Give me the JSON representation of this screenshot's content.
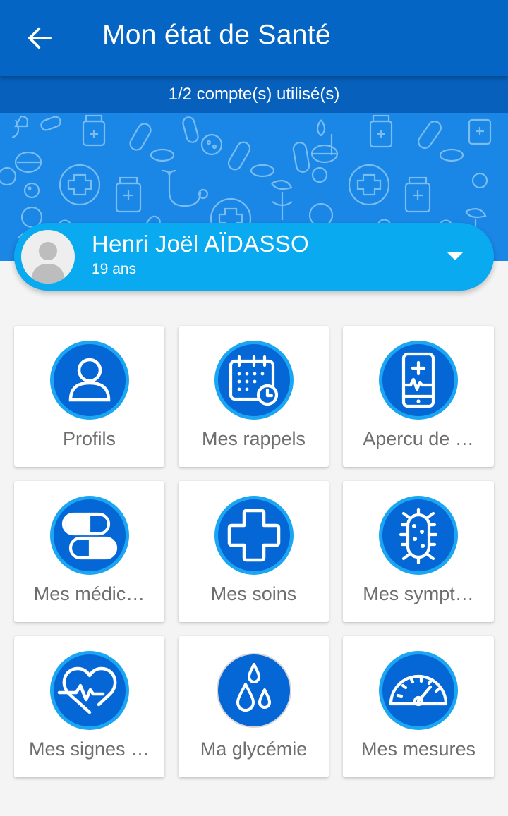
{
  "appbar": {
    "title": "Mon état de Santé",
    "back_icon": "arrow-left-icon"
  },
  "accounts_info": "1/2 compte(s) utilisé(s)",
  "profile": {
    "name": "Henri Joël AÏDASSO",
    "age": "19 ans"
  },
  "menu": [
    {
      "label": "Profils",
      "icon": "user-icon"
    },
    {
      "label": "Mes rappels",
      "icon": "calendar-clock-icon"
    },
    {
      "label": "Apercu de …",
      "icon": "phone-health-icon"
    },
    {
      "label": "Mes médic…",
      "icon": "pills-icon"
    },
    {
      "label": "Mes soins",
      "icon": "cross-icon"
    },
    {
      "label": "Mes sympt…",
      "icon": "bacteria-icon"
    },
    {
      "label": "Mes signes …",
      "icon": "heart-pulse-icon"
    },
    {
      "label": "Ma glycémie",
      "icon": "drops-icon"
    },
    {
      "label": "Mes mesures",
      "icon": "gauge-icon"
    }
  ],
  "colors": {
    "appbar": "#0565c4",
    "subbar": "#0760bb",
    "banner": "#1a86e6",
    "pill": "#0aaaf0",
    "icon_fill": "#0567d6",
    "icon_ring": "#1aa6f2",
    "label": "#6e6e6e"
  }
}
